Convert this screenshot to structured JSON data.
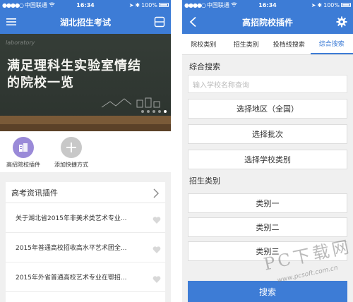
{
  "left": {
    "status": {
      "carrier": "中国联通",
      "time": "16:34",
      "battery": "100%"
    },
    "nav": {
      "title": "湖北招生考试",
      "menu_icon": "menu-icon",
      "scan_icon": "scan-icon"
    },
    "banner": {
      "headline_1": "满足理科生实验室情结",
      "headline_2": "的院校一览",
      "watermark": "laboratory"
    },
    "shortcuts": [
      {
        "label": "高招院校插件",
        "icon": "school-plugin-icon"
      },
      {
        "label": "添加快捷方式",
        "icon": "plus-icon"
      }
    ],
    "news": {
      "title": "高考资讯插件",
      "items": [
        "关于湖北省2015年非美术类艺术专业...",
        "2015年普通高校招收高水平艺术团全...",
        "2015年外省普通高校艺术专业在鄂招..."
      ]
    }
  },
  "right": {
    "status": {
      "carrier": "中国联通",
      "time": "16:34",
      "battery": "100%"
    },
    "nav": {
      "title": "高招院校插件",
      "back_icon": "back-arrow-icon",
      "settings_icon": "gear-icon"
    },
    "tabs": [
      "院校类别",
      "招生类别",
      "投档线搜索",
      "综合搜索"
    ],
    "active_tab": "综合搜索",
    "search_section": "综合搜索",
    "search_placeholder": "输入学校名称查询",
    "options": [
      "选择地区（全国）",
      "选择批次",
      "选择学校类别"
    ],
    "category_section": "招生类别",
    "categories": [
      "类别一",
      "类别二",
      "类别三"
    ],
    "submit_label": "搜索"
  },
  "watermark": {
    "text": "PC下载网",
    "url": "www.pcsoft.com.cn"
  },
  "colors": {
    "primary": "#3d7cd6",
    "accent_purple": "#9a8ad8",
    "background": "#f0f0f0"
  }
}
